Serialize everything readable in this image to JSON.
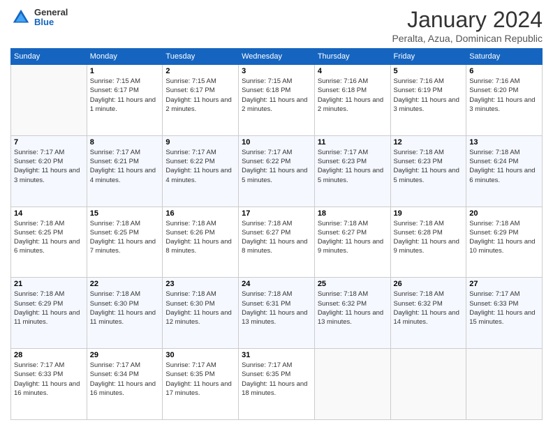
{
  "header": {
    "logo_general": "General",
    "logo_blue": "Blue",
    "month_title": "January 2024",
    "location": "Peralta, Azua, Dominican Republic"
  },
  "weekdays": [
    "Sunday",
    "Monday",
    "Tuesday",
    "Wednesday",
    "Thursday",
    "Friday",
    "Saturday"
  ],
  "weeks": [
    [
      {
        "day": "",
        "sunrise": "",
        "sunset": "",
        "daylight": ""
      },
      {
        "day": "1",
        "sunrise": "Sunrise: 7:15 AM",
        "sunset": "Sunset: 6:17 PM",
        "daylight": "Daylight: 11 hours and 1 minute."
      },
      {
        "day": "2",
        "sunrise": "Sunrise: 7:15 AM",
        "sunset": "Sunset: 6:17 PM",
        "daylight": "Daylight: 11 hours and 2 minutes."
      },
      {
        "day": "3",
        "sunrise": "Sunrise: 7:15 AM",
        "sunset": "Sunset: 6:18 PM",
        "daylight": "Daylight: 11 hours and 2 minutes."
      },
      {
        "day": "4",
        "sunrise": "Sunrise: 7:16 AM",
        "sunset": "Sunset: 6:18 PM",
        "daylight": "Daylight: 11 hours and 2 minutes."
      },
      {
        "day": "5",
        "sunrise": "Sunrise: 7:16 AM",
        "sunset": "Sunset: 6:19 PM",
        "daylight": "Daylight: 11 hours and 3 minutes."
      },
      {
        "day": "6",
        "sunrise": "Sunrise: 7:16 AM",
        "sunset": "Sunset: 6:20 PM",
        "daylight": "Daylight: 11 hours and 3 minutes."
      }
    ],
    [
      {
        "day": "7",
        "sunrise": "Sunrise: 7:17 AM",
        "sunset": "Sunset: 6:20 PM",
        "daylight": "Daylight: 11 hours and 3 minutes."
      },
      {
        "day": "8",
        "sunrise": "Sunrise: 7:17 AM",
        "sunset": "Sunset: 6:21 PM",
        "daylight": "Daylight: 11 hours and 4 minutes."
      },
      {
        "day": "9",
        "sunrise": "Sunrise: 7:17 AM",
        "sunset": "Sunset: 6:22 PM",
        "daylight": "Daylight: 11 hours and 4 minutes."
      },
      {
        "day": "10",
        "sunrise": "Sunrise: 7:17 AM",
        "sunset": "Sunset: 6:22 PM",
        "daylight": "Daylight: 11 hours and 5 minutes."
      },
      {
        "day": "11",
        "sunrise": "Sunrise: 7:17 AM",
        "sunset": "Sunset: 6:23 PM",
        "daylight": "Daylight: 11 hours and 5 minutes."
      },
      {
        "day": "12",
        "sunrise": "Sunrise: 7:18 AM",
        "sunset": "Sunset: 6:23 PM",
        "daylight": "Daylight: 11 hours and 5 minutes."
      },
      {
        "day": "13",
        "sunrise": "Sunrise: 7:18 AM",
        "sunset": "Sunset: 6:24 PM",
        "daylight": "Daylight: 11 hours and 6 minutes."
      }
    ],
    [
      {
        "day": "14",
        "sunrise": "Sunrise: 7:18 AM",
        "sunset": "Sunset: 6:25 PM",
        "daylight": "Daylight: 11 hours and 6 minutes."
      },
      {
        "day": "15",
        "sunrise": "Sunrise: 7:18 AM",
        "sunset": "Sunset: 6:25 PM",
        "daylight": "Daylight: 11 hours and 7 minutes."
      },
      {
        "day": "16",
        "sunrise": "Sunrise: 7:18 AM",
        "sunset": "Sunset: 6:26 PM",
        "daylight": "Daylight: 11 hours and 8 minutes."
      },
      {
        "day": "17",
        "sunrise": "Sunrise: 7:18 AM",
        "sunset": "Sunset: 6:27 PM",
        "daylight": "Daylight: 11 hours and 8 minutes."
      },
      {
        "day": "18",
        "sunrise": "Sunrise: 7:18 AM",
        "sunset": "Sunset: 6:27 PM",
        "daylight": "Daylight: 11 hours and 9 minutes."
      },
      {
        "day": "19",
        "sunrise": "Sunrise: 7:18 AM",
        "sunset": "Sunset: 6:28 PM",
        "daylight": "Daylight: 11 hours and 9 minutes."
      },
      {
        "day": "20",
        "sunrise": "Sunrise: 7:18 AM",
        "sunset": "Sunset: 6:29 PM",
        "daylight": "Daylight: 11 hours and 10 minutes."
      }
    ],
    [
      {
        "day": "21",
        "sunrise": "Sunrise: 7:18 AM",
        "sunset": "Sunset: 6:29 PM",
        "daylight": "Daylight: 11 hours and 11 minutes."
      },
      {
        "day": "22",
        "sunrise": "Sunrise: 7:18 AM",
        "sunset": "Sunset: 6:30 PM",
        "daylight": "Daylight: 11 hours and 11 minutes."
      },
      {
        "day": "23",
        "sunrise": "Sunrise: 7:18 AM",
        "sunset": "Sunset: 6:30 PM",
        "daylight": "Daylight: 11 hours and 12 minutes."
      },
      {
        "day": "24",
        "sunrise": "Sunrise: 7:18 AM",
        "sunset": "Sunset: 6:31 PM",
        "daylight": "Daylight: 11 hours and 13 minutes."
      },
      {
        "day": "25",
        "sunrise": "Sunrise: 7:18 AM",
        "sunset": "Sunset: 6:32 PM",
        "daylight": "Daylight: 11 hours and 13 minutes."
      },
      {
        "day": "26",
        "sunrise": "Sunrise: 7:18 AM",
        "sunset": "Sunset: 6:32 PM",
        "daylight": "Daylight: 11 hours and 14 minutes."
      },
      {
        "day": "27",
        "sunrise": "Sunrise: 7:17 AM",
        "sunset": "Sunset: 6:33 PM",
        "daylight": "Daylight: 11 hours and 15 minutes."
      }
    ],
    [
      {
        "day": "28",
        "sunrise": "Sunrise: 7:17 AM",
        "sunset": "Sunset: 6:33 PM",
        "daylight": "Daylight: 11 hours and 16 minutes."
      },
      {
        "day": "29",
        "sunrise": "Sunrise: 7:17 AM",
        "sunset": "Sunset: 6:34 PM",
        "daylight": "Daylight: 11 hours and 16 minutes."
      },
      {
        "day": "30",
        "sunrise": "Sunrise: 7:17 AM",
        "sunset": "Sunset: 6:35 PM",
        "daylight": "Daylight: 11 hours and 17 minutes."
      },
      {
        "day": "31",
        "sunrise": "Sunrise: 7:17 AM",
        "sunset": "Sunset: 6:35 PM",
        "daylight": "Daylight: 11 hours and 18 minutes."
      },
      {
        "day": "",
        "sunrise": "",
        "sunset": "",
        "daylight": ""
      },
      {
        "day": "",
        "sunrise": "",
        "sunset": "",
        "daylight": ""
      },
      {
        "day": "",
        "sunrise": "",
        "sunset": "",
        "daylight": ""
      }
    ]
  ]
}
